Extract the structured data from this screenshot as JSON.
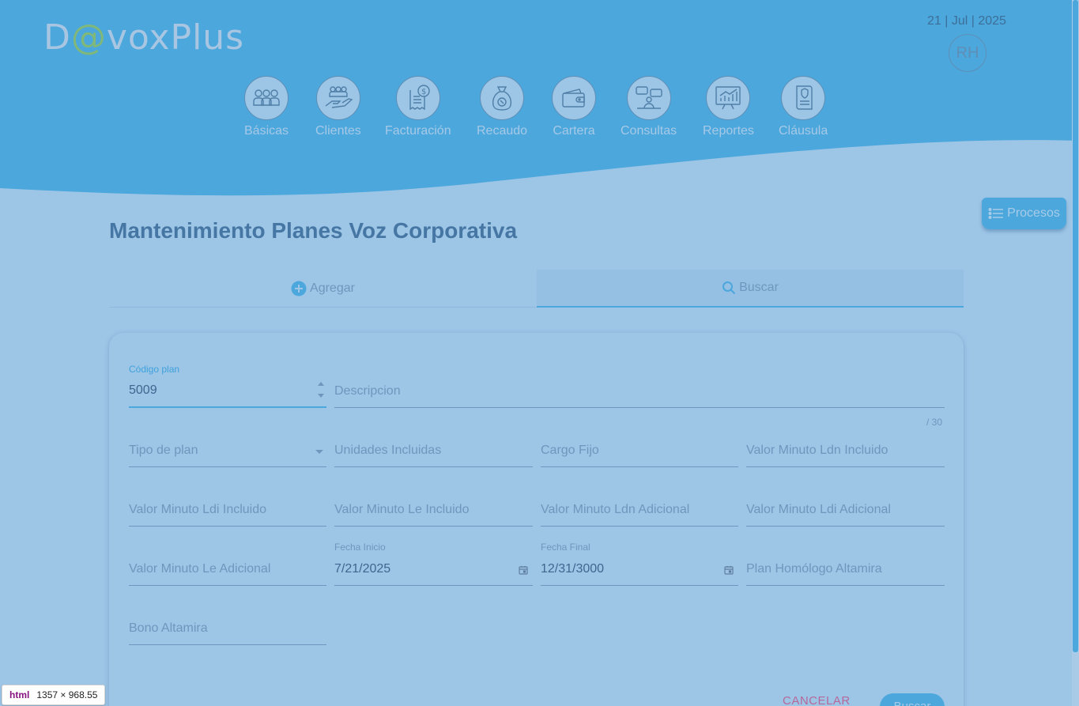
{
  "header": {
    "logo_prefix": "D",
    "logo_at": "@",
    "logo_suffix": "voxPlus",
    "date": "21 | Jul | 2025",
    "avatar_initials": "RH"
  },
  "nav": {
    "items": [
      {
        "label": "Básicas",
        "icon": "users-group-icon"
      },
      {
        "label": "Clientes",
        "icon": "hand-users-icon"
      },
      {
        "label": "Facturación",
        "icon": "invoice-dollar-icon"
      },
      {
        "label": "Recaudo",
        "icon": "money-bag-icon"
      },
      {
        "label": "Cartera",
        "icon": "wallet-icon"
      },
      {
        "label": "Consultas",
        "icon": "chat-people-icon"
      },
      {
        "label": "Reportes",
        "icon": "chart-report-icon"
      },
      {
        "label": "Cláusula",
        "icon": "contract-shield-icon"
      }
    ]
  },
  "procesos_button": {
    "label": "Procesos",
    "icon": "list-icon"
  },
  "page": {
    "title": "Mantenimiento Planes Voz Corporativa"
  },
  "tabs": {
    "add_label": "Agregar",
    "search_label": "Buscar",
    "active": "Buscar"
  },
  "form": {
    "codigo_plan": {
      "label": "Código plan",
      "value": "5009"
    },
    "descripcion": {
      "placeholder": "Descripcion",
      "counter": "/ 30"
    },
    "tipo_plan": {
      "placeholder": "Tipo de plan"
    },
    "unidades_incluidas": {
      "placeholder": "Unidades Incluidas"
    },
    "cargo_fijo": {
      "placeholder": "Cargo Fijo"
    },
    "valor_min_ldn_incluido": {
      "placeholder": "Valor Minuto Ldn Incluido"
    },
    "valor_min_ldi_incluido": {
      "placeholder": "Valor Minuto Ldi Incluido"
    },
    "valor_min_le_incluido": {
      "placeholder": "Valor Minuto Le Incluido"
    },
    "valor_min_ldn_adicional": {
      "placeholder": "Valor Minuto Ldn Adicional"
    },
    "valor_min_ldi_adicional": {
      "placeholder": "Valor Minuto Ldi Adicional"
    },
    "valor_min_le_adicional": {
      "placeholder": "Valor Minuto Le Adicional"
    },
    "fecha_inicio": {
      "label": "Fecha Inicio",
      "value": "7/21/2025"
    },
    "fecha_final": {
      "label": "Fecha Final",
      "value": "12/31/3000"
    },
    "plan_homologo": {
      "placeholder": "Plan Homólogo Altamira"
    },
    "bono_altamira": {
      "placeholder": "Bono Altamira"
    }
  },
  "actions": {
    "cancel_label": "CANCELAR",
    "submit_label": "Buscar"
  },
  "devtools": {
    "tag": "html",
    "size": "1357 × 968.55"
  },
  "colors": {
    "primary": "#4ba7dc",
    "page_bg": "#9dc5e6",
    "title": "#4676a3",
    "cancel": "#b5699a"
  }
}
